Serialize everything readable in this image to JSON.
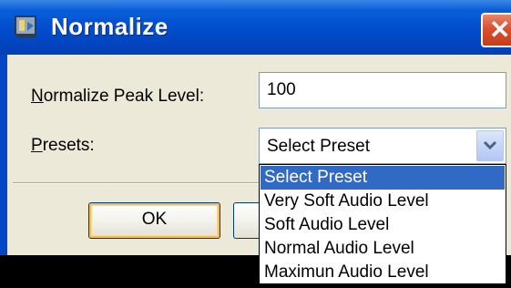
{
  "window": {
    "title": "Normalize",
    "close_glyph": "✕",
    "icon": "app-icon"
  },
  "form": {
    "peak_label_underlined": "N",
    "peak_label_rest": "ormalize Peak Level:",
    "peak_value": "100",
    "presets_label_underlined": "P",
    "presets_label_rest": "resets:",
    "presets_selected": "Select Preset"
  },
  "buttons": {
    "ok_label": "OK"
  },
  "dropdown": {
    "options": [
      "Select Preset",
      "Very Soft Audio Level",
      "Soft Audio Level",
      "Normal Audio Level",
      "Maximun Audio Level"
    ],
    "highlighted_index": 0
  },
  "colors": {
    "titlebar": "#0350d0",
    "dialog_bg": "#ece9d8",
    "highlight": "#316ac5",
    "close_button": "#d9502f"
  }
}
